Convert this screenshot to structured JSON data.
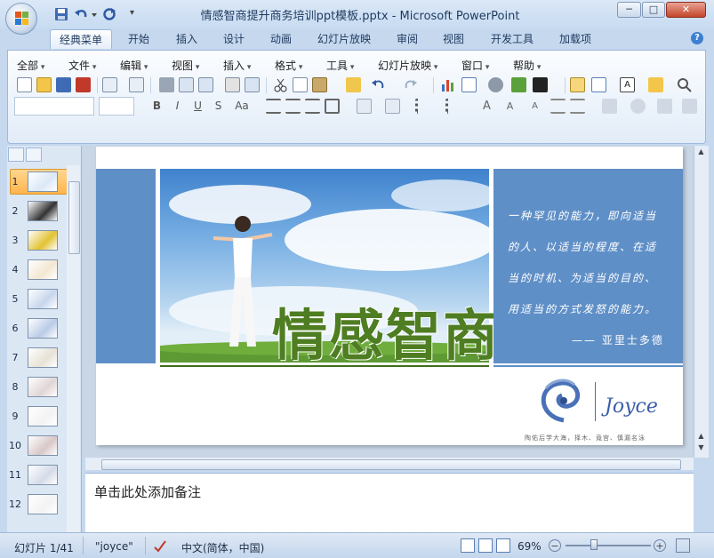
{
  "window": {
    "title": "情感智商提升商务培训ppt模板.pptx - Microsoft PowerPoint",
    "minimize_label": "─",
    "maximize_label": "□",
    "close_label": "✕"
  },
  "quick_access": {
    "overflow_label": "▾"
  },
  "ribbon_tabs": [
    {
      "label": "经典菜单",
      "active": true
    },
    {
      "label": "开始"
    },
    {
      "label": "插入"
    },
    {
      "label": "设计"
    },
    {
      "label": "动画"
    },
    {
      "label": "幻灯片放映"
    },
    {
      "label": "审阅"
    },
    {
      "label": "视图"
    },
    {
      "label": "开发工具"
    },
    {
      "label": "加载项"
    }
  ],
  "help_label": "?",
  "classic_menu": [
    "全部",
    "文件",
    "编辑",
    "视图",
    "插入",
    "格式",
    "工具",
    "幻灯片放映",
    "窗口",
    "帮助"
  ],
  "format_buttons": {
    "bold": "B",
    "italic": "I",
    "underline": "U",
    "strike": "S",
    "case": "Aa"
  },
  "slide_thumbnails": [
    "1",
    "2",
    "3",
    "4",
    "5",
    "6",
    "7",
    "8",
    "9",
    "10",
    "11",
    "12"
  ],
  "slide": {
    "headline": "情感智商",
    "quote_lines": [
      "一种罕见的能力，即向适当",
      "的人、以适当的程度、在适",
      "当的时机、为适当的目的、",
      "用适当的方式发怒的能力。"
    ],
    "quote_author": "—— 亚里士多德",
    "brand_name": "Joyce",
    "brand_tagline": "陶佑后学大海，择木、竟宫、慎漏名泳"
  },
  "notes_placeholder": "单击此处添加备注",
  "status": {
    "slide_counter": "幻灯片 1/41",
    "theme_name": "\"joyce\"",
    "language": "中文(简体，中国)",
    "zoom": "69%"
  },
  "colors": {
    "slide_blue": "#5f8fc7",
    "headline_green": "#4e7d22",
    "ribbon_blue": "#c5d8ee"
  }
}
